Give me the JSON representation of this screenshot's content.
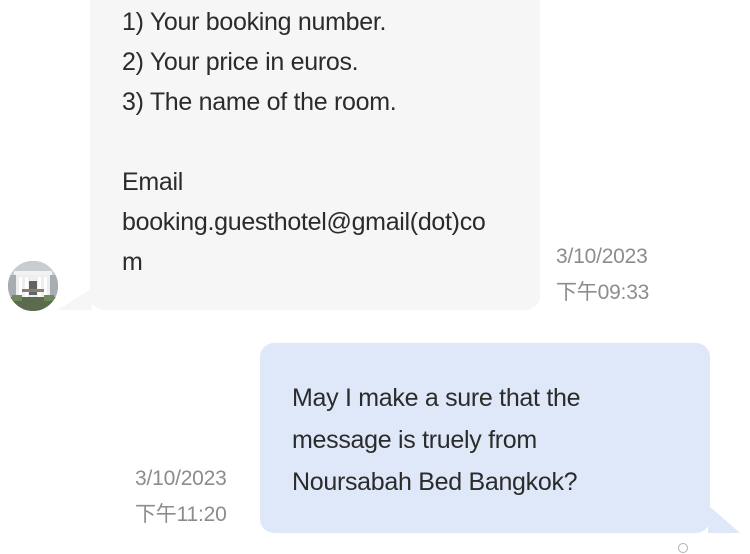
{
  "incoming_message": {
    "lines": [
      "1) Your booking number.",
      "2) Your price in euros.",
      "3) The name of the room.",
      "",
      "Email",
      "booking.guesthotel@gmail(dot)co",
      "m"
    ],
    "timestamp_date": "3/10/2023",
    "timestamp_time": "下午09:33",
    "avatar_icon": "hotel-building-photo"
  },
  "outgoing_message": {
    "lines": [
      "May I make a sure that the",
      "message is truely from",
      "Noursabah Bed Bangkok?"
    ],
    "timestamp_date": "3/10/2023",
    "timestamp_time": "下午11:20"
  },
  "colors": {
    "incoming_bubble": "#f6f6f6",
    "outgoing_bubble": "#dfe8f8",
    "timestamp_text": "#8c8c8c",
    "message_text": "#2b2b2b"
  }
}
